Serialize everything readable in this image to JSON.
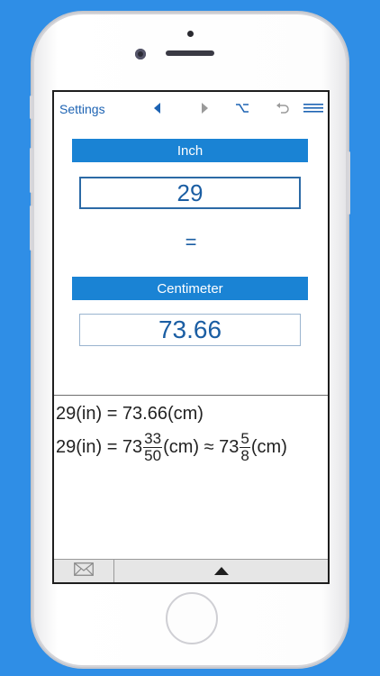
{
  "toolbar": {
    "settings_label": "Settings",
    "icons": [
      "left-arrow-icon",
      "right-arrow-icon",
      "option-key-icon",
      "undo-icon",
      "menu-icon"
    ]
  },
  "converter": {
    "from_unit": "Inch",
    "from_value": "29",
    "equals": "=",
    "to_unit": "Centimeter",
    "to_value": "73.66"
  },
  "result": {
    "line1": "29(in) = 73.66(cm)",
    "line2_prefix": "29(in) = 73",
    "frac1_num": "33",
    "frac1_den": "50",
    "line2_mid": "(cm) ≈ 73",
    "frac2_num": "5",
    "frac2_den": "8",
    "line2_suffix": "(cm)"
  },
  "bottom": {
    "icons": [
      "mail-icon",
      "up-arrow-icon"
    ]
  },
  "colors": {
    "background": "#2f8ee6",
    "header_bar": "#1a83d4",
    "value_text": "#1b5ea3",
    "toolbar_icon": "#1d63b3"
  }
}
